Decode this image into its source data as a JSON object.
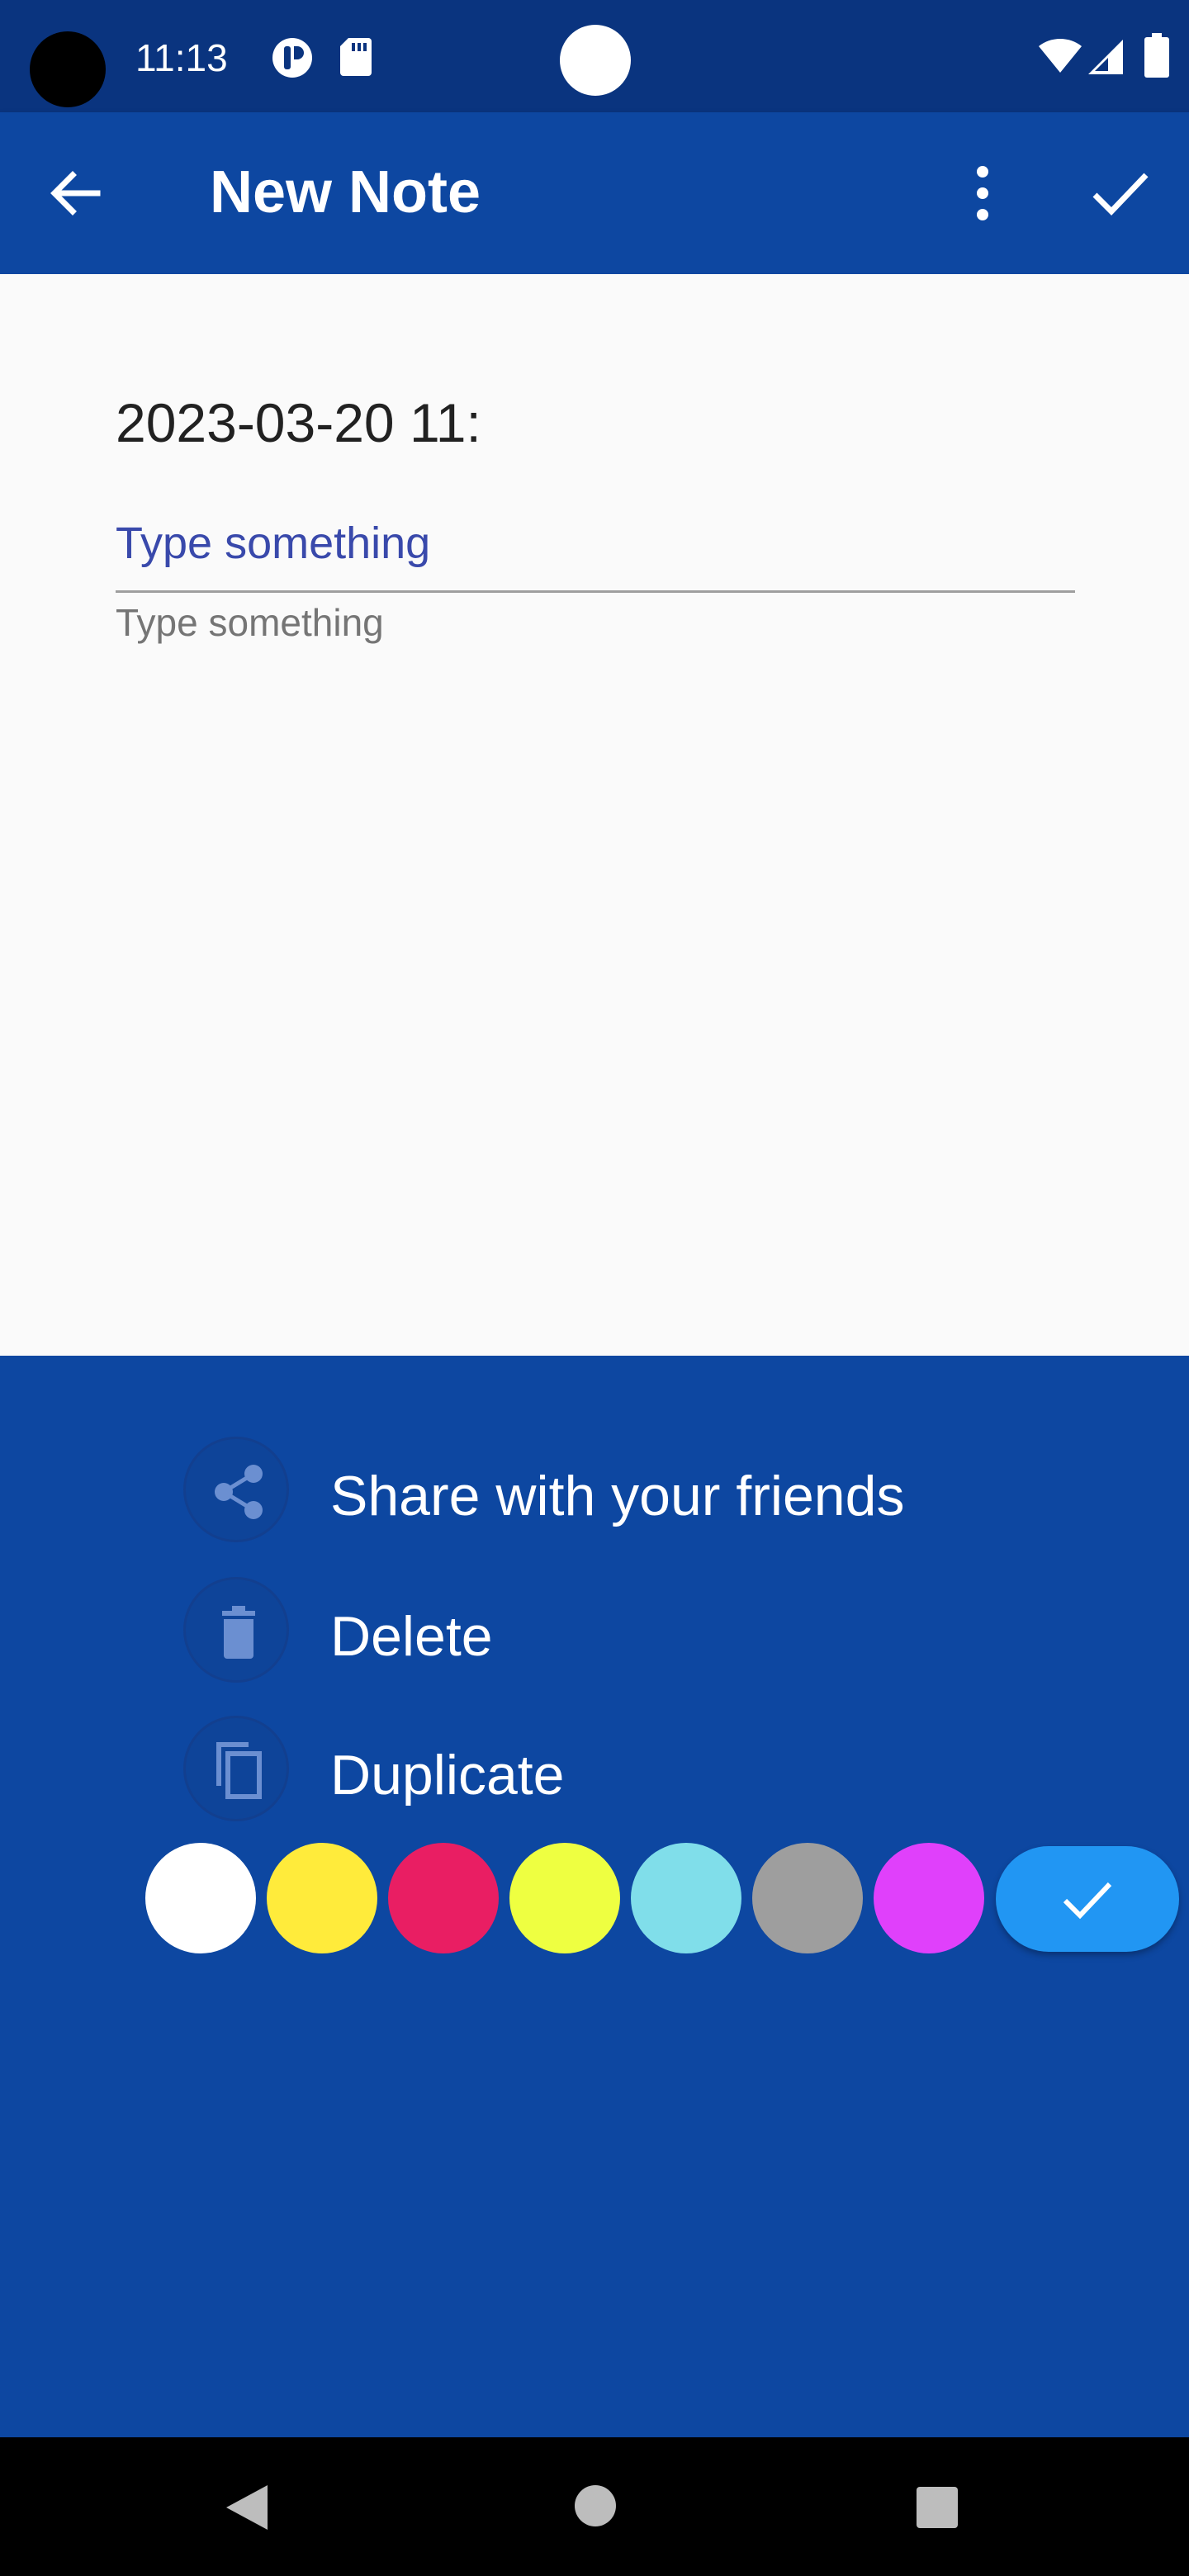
{
  "status_bar": {
    "time": "11:13"
  },
  "app_bar": {
    "title": "New Note"
  },
  "editor": {
    "date": "2023-03-20 11:",
    "title_placeholder": "Type something",
    "body_placeholder": "Type something"
  },
  "sheet": {
    "actions": [
      {
        "label": "Share with your friends",
        "icon": "share-icon"
      },
      {
        "label": "Delete",
        "icon": "trash-icon"
      },
      {
        "label": "Duplicate",
        "icon": "copy-icon"
      }
    ],
    "colors": [
      "#ffffff",
      "#ffeb3b",
      "#e91e63",
      "#eeff41",
      "#80deea",
      "#9e9e9e",
      "#e040fb"
    ],
    "done_color": "#2196f3"
  }
}
